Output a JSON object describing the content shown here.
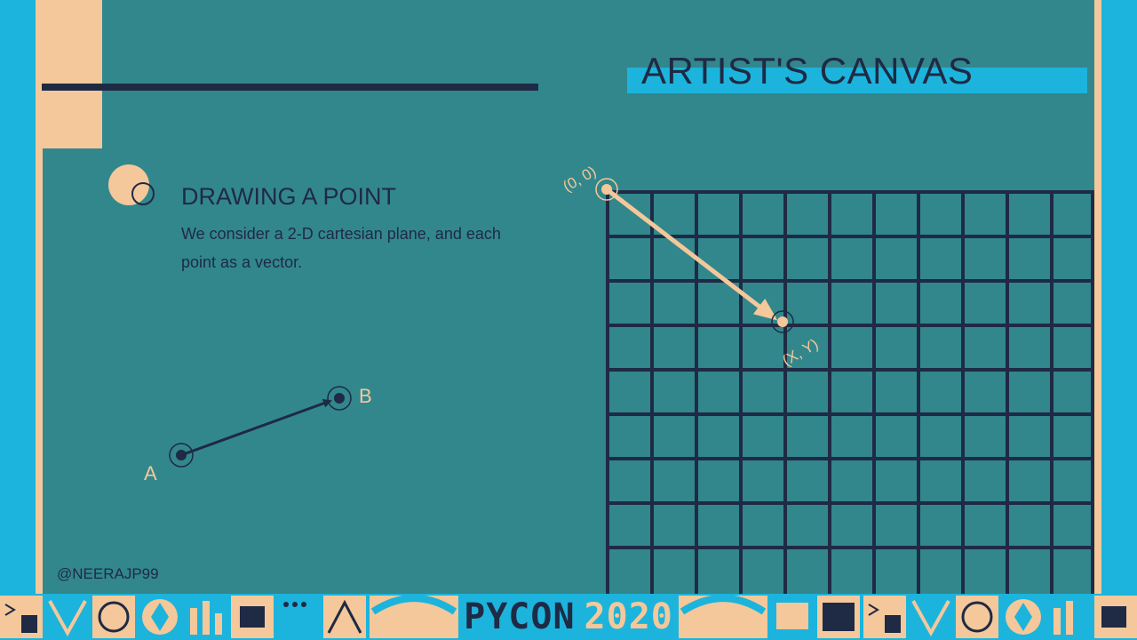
{
  "slide": {
    "title": "ARTIST'S CANVAS",
    "heading": "DRAWING A POINT",
    "body": "We consider a 2-D cartesian plane, and each point as a vector.",
    "handle": "@NEERAJP99"
  },
  "diagram": {
    "point_a_label": "A",
    "point_b_label": "B",
    "origin_label": "(0, 0)",
    "target_label": "(X, Y)"
  },
  "footer": {
    "brand_word": "PYCON",
    "brand_year": "2020"
  },
  "colors": {
    "background": "#32878c",
    "accent": "#1cb4dc",
    "peach": "#f4c89a",
    "navy": "#1f2a44"
  }
}
